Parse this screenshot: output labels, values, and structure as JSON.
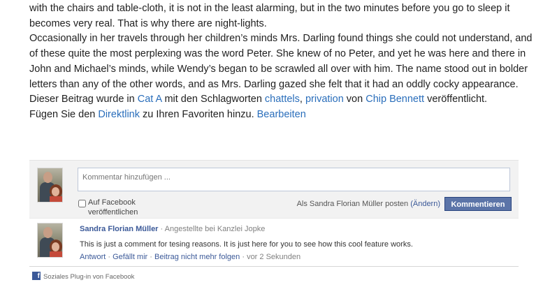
{
  "article": {
    "line1": "with the chairs and table-cloth, it is not in the least alarming, but in the two minutes before you go to sleep it",
    "line2": "becomes very real. That is why there are night-lights.",
    "paragraph": "Occasionally in her travels through her children’s minds Mrs. Darling found things she could not understand, and of these quite the most perplexing was the word Peter. She knew of no Peter, and yet he was here and there in John and Michael’s minds, while Wendy’s began to be scrawled all over with him. The name stood out in bolder letters than any of the other words, and as Mrs. Darling gazed she felt that it had an oddly cocky appearance.",
    "meta": {
      "prefix": "Dieser Beitrag wurde in ",
      "category": "Cat A",
      "mid": " mit den Schlagworten ",
      "tag1": "chattels",
      "comma": ", ",
      "tag2": "privation",
      "by": " von ",
      "author": "Chip Bennett",
      "suffix": " veröffentlicht.",
      "line2_prefix": "Fügen Sie den ",
      "permalink": "Direktlink",
      "line2_mid": " zu Ihren Favoriten hinzu. ",
      "edit": "Bearbeiten"
    }
  },
  "fb_comments": {
    "input_placeholder": "Kommentar hinzufügen ...",
    "post_to_facebook": "Auf Facebook veröffentlichen",
    "posting_as": "Als Sandra Florian Müller posten",
    "change": "(Ändern)",
    "submit": "Kommentieren",
    "comment": {
      "author": "Sandra Florian Müller",
      "role": " · Angestellte bei Kanzlei Jopke",
      "text": "This is just a comment for tesing reasons. It is just here for you to see how this cool feature works.",
      "reply": "Antwort",
      "sep": " · ",
      "like": "Gefällt mir",
      "unfollow": "Beitrag nicht mehr folgen",
      "time": "vor 2 Sekunden"
    },
    "plugin_label": "Soziales Plug-in von Facebook",
    "logo_letter": "f"
  },
  "colors": {
    "link": "#2a6ebb",
    "fb_blue": "#3b5998",
    "button": "#5b74a8"
  }
}
